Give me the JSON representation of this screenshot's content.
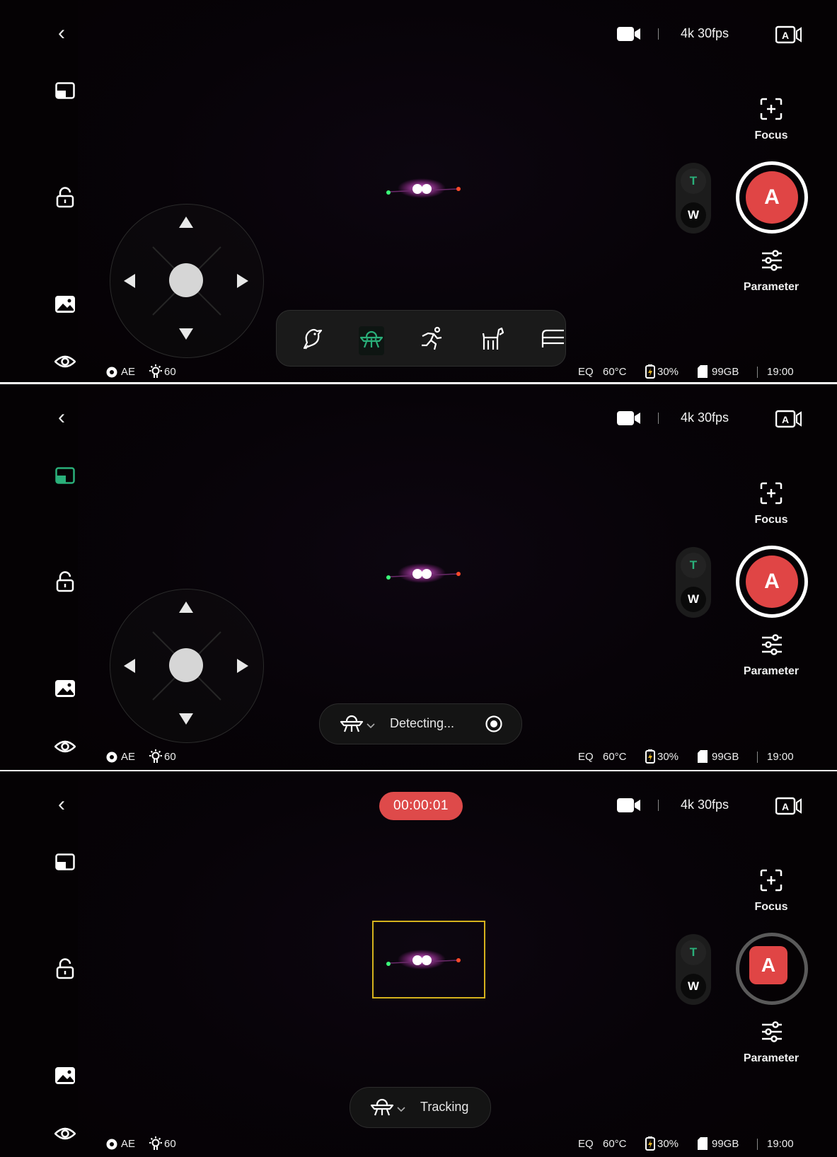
{
  "panels": [
    {
      "top_bar": {
        "video_resolution": "4k 30fps",
        "icons": [
          "back-chevron-icon",
          "video-camera-icon",
          "auto-video-mode-icon"
        ]
      },
      "left_sidebar": {
        "icons": [
          "picture-in-picture-icon",
          "unlock-icon",
          "gallery-icon",
          "eye-icon"
        ],
        "pip_active": false
      },
      "zoom_toggle": {
        "tele": "T",
        "wide": "W"
      },
      "shutter": {
        "label": "A",
        "recording": false
      },
      "focus_label": "Focus",
      "parameter_label": "Parameter",
      "target_toolbar": {
        "items": [
          "bird-icon",
          "ufo-icon",
          "running-person-icon",
          "dog-icon",
          "car-icon"
        ],
        "selected": "ufo-icon"
      },
      "status": {
        "left": {
          "ae": "AE",
          "exposure": "60"
        },
        "right": {
          "eq": "EQ",
          "temperature": "60°C",
          "battery": "30%",
          "storage": "99GB",
          "time": "19:00"
        }
      }
    },
    {
      "top_bar": {
        "video_resolution": "4k 30fps",
        "icons": [
          "back-chevron-icon",
          "video-camera-icon",
          "auto-video-mode-icon"
        ]
      },
      "left_sidebar": {
        "icons": [
          "picture-in-picture-icon",
          "unlock-icon",
          "gallery-icon",
          "eye-icon"
        ],
        "pip_active": true,
        "active_color": "#2ab07a"
      },
      "zoom_toggle": {
        "tele": "T",
        "wide": "W"
      },
      "shutter": {
        "label": "A",
        "recording": false
      },
      "focus_label": "Focus",
      "parameter_label": "Parameter",
      "detect_pill": {
        "target_icon": "ufo-icon",
        "text": "Detecting..."
      },
      "status": {
        "left": {
          "ae": "AE",
          "exposure": "60"
        },
        "right": {
          "eq": "EQ",
          "temperature": "60°C",
          "battery": "30%",
          "storage": "99GB",
          "time": "19:00"
        }
      }
    },
    {
      "top_bar": {
        "video_resolution": "4k 30fps",
        "icons": [
          "back-chevron-icon",
          "video-camera-icon",
          "auto-video-mode-icon"
        ]
      },
      "record_timer": "00:00:01",
      "left_sidebar": {
        "icons": [
          "picture-in-picture-icon",
          "unlock-icon",
          "gallery-icon",
          "eye-icon"
        ],
        "pip_active": false
      },
      "zoom_toggle": {
        "tele": "T",
        "wide": "W"
      },
      "shutter": {
        "label": "A",
        "recording": true
      },
      "focus_label": "Focus",
      "parameter_label": "Parameter",
      "tracking_box_color": "#d5b21d",
      "track_pill": {
        "target_icon": "ufo-icon",
        "text": "Tracking"
      },
      "status": {
        "left": {
          "ae": "AE",
          "exposure": "60"
        },
        "right": {
          "eq": "EQ",
          "temperature": "60°C",
          "battery": "30%",
          "storage": "99GB",
          "time": "19:00"
        }
      }
    }
  ],
  "colors": {
    "accent_green": "#2ab07a",
    "record_red": "#e04545",
    "tracking_yellow": "#d5b21d",
    "subject_magenta": "#ff3cf0"
  }
}
